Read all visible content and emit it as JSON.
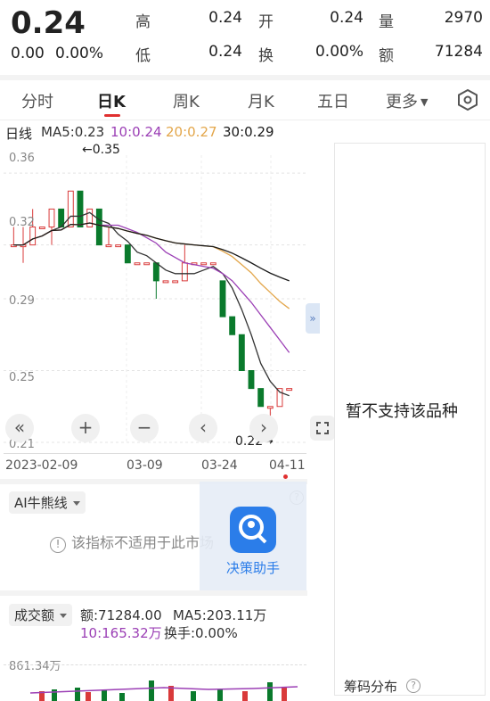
{
  "quote": {
    "price": "0.24",
    "change": "0.00",
    "change_pct": "0.00%",
    "high_label": "高",
    "high": "0.24",
    "open_label": "开",
    "open": "0.24",
    "volume_label": "量",
    "volume": "2970",
    "low_label": "低",
    "low": "0.24",
    "turnover_label": "换",
    "turnover": "0.00%",
    "amount_label": "额",
    "amount": "71284"
  },
  "tabs": [
    "分时",
    "日K",
    "周K",
    "月K",
    "五日",
    "更多"
  ],
  "active_tab": "日K",
  "ma": {
    "period": "日线",
    "ma5": "MA5:0.23",
    "ma10": "10:0.24",
    "ma20": "20:0.27",
    "ma30": "30:0.29"
  },
  "chart": {
    "y_ticks": [
      "0.36",
      "0.32",
      "0.29",
      "0.25",
      "0.21"
    ],
    "high_note": "←0.35",
    "low_note": "0.22→",
    "dates": [
      "2023-02-09",
      "03-09",
      "03-24",
      "04-11"
    ],
    "side_tab": "»"
  },
  "chart_data": {
    "type": "candlestick",
    "title": "",
    "y_ticks": [
      0.36,
      0.32,
      0.29,
      0.25,
      0.21
    ],
    "ylim": [
      0.21,
      0.37
    ],
    "x_ticks": [
      "2023-02-09",
      "03-09",
      "03-24",
      "04-11"
    ],
    "annotations": [
      {
        "text": "←0.35",
        "value": 0.35
      },
      {
        "text": "0.22→",
        "value": 0.22
      }
    ],
    "indicators": {
      "MA5": 0.23,
      "MA10": 0.24,
      "MA20": 0.27,
      "MA30": 0.29
    },
    "candles": [
      {
        "o": 0.32,
        "c": 0.32,
        "h": 0.33,
        "l": 0.32
      },
      {
        "o": 0.32,
        "c": 0.32,
        "h": 0.33,
        "l": 0.31
      },
      {
        "o": 0.32,
        "c": 0.33,
        "h": 0.34,
        "l": 0.32
      },
      {
        "o": 0.33,
        "c": 0.33,
        "h": 0.33,
        "l": 0.33
      },
      {
        "o": 0.33,
        "c": 0.34,
        "h": 0.34,
        "l": 0.32
      },
      {
        "o": 0.34,
        "c": 0.33,
        "h": 0.34,
        "l": 0.33
      },
      {
        "o": 0.33,
        "c": 0.35,
        "h": 0.35,
        "l": 0.33
      },
      {
        "o": 0.35,
        "c": 0.33,
        "h": 0.35,
        "l": 0.33
      },
      {
        "o": 0.33,
        "c": 0.34,
        "h": 0.34,
        "l": 0.33
      },
      {
        "o": 0.34,
        "c": 0.32,
        "h": 0.34,
        "l": 0.32
      },
      {
        "o": 0.32,
        "c": 0.32,
        "h": 0.33,
        "l": 0.32
      },
      {
        "o": 0.32,
        "c": 0.32,
        "h": 0.32,
        "l": 0.32
      },
      {
        "o": 0.32,
        "c": 0.31,
        "h": 0.32,
        "l": 0.31
      },
      {
        "o": 0.31,
        "c": 0.31,
        "h": 0.31,
        "l": 0.31
      },
      {
        "o": 0.31,
        "c": 0.31,
        "h": 0.31,
        "l": 0.31
      },
      {
        "o": 0.31,
        "c": 0.3,
        "h": 0.31,
        "l": 0.29
      },
      {
        "o": 0.3,
        "c": 0.3,
        "h": 0.3,
        "l": 0.3
      },
      {
        "o": 0.3,
        "c": 0.3,
        "h": 0.3,
        "l": 0.3
      },
      {
        "o": 0.3,
        "c": 0.31,
        "h": 0.32,
        "l": 0.3
      },
      {
        "o": 0.31,
        "c": 0.31,
        "h": 0.31,
        "l": 0.31
      },
      {
        "o": 0.31,
        "c": 0.31,
        "h": 0.31,
        "l": 0.31
      },
      {
        "o": 0.31,
        "c": 0.31,
        "h": 0.31,
        "l": 0.31
      },
      {
        "o": 0.3,
        "c": 0.28,
        "h": 0.3,
        "l": 0.28
      },
      {
        "o": 0.28,
        "c": 0.27,
        "h": 0.28,
        "l": 0.27
      },
      {
        "o": 0.27,
        "c": 0.25,
        "h": 0.27,
        "l": 0.25
      },
      {
        "o": 0.25,
        "c": 0.24,
        "h": 0.25,
        "l": 0.24
      },
      {
        "o": 0.24,
        "c": 0.23,
        "h": 0.24,
        "l": 0.23
      },
      {
        "o": 0.23,
        "c": 0.23,
        "h": 0.23,
        "l": 0.22
      },
      {
        "o": 0.23,
        "c": 0.24,
        "h": 0.24,
        "l": 0.23
      },
      {
        "o": 0.24,
        "c": 0.24,
        "h": 0.24,
        "l": 0.24
      }
    ]
  },
  "controls": [
    "«",
    "+",
    "−",
    "‹",
    "›"
  ],
  "ai_section": {
    "selector_label": "AI牛熊线",
    "message": "该指标不适用于此市场",
    "decision_label": "决策助手"
  },
  "volume_section": {
    "selector_label": "成交额",
    "amount": "额:71284.00",
    "ma5": "MA5:203.11万",
    "ma10": "10:165.32万",
    "turnover": "换手:0.00%",
    "y_tick": "861.34万"
  },
  "right_panel": {
    "message": "暂不支持该品种",
    "footer": "筹码分布"
  },
  "colors": {
    "up": "#d93a3a",
    "down": "#0a7a2c",
    "ma5": "#333333",
    "ma10": "#9b3fb5",
    "ma20": "#e3a64a",
    "ma30": "#1a1a1a"
  }
}
